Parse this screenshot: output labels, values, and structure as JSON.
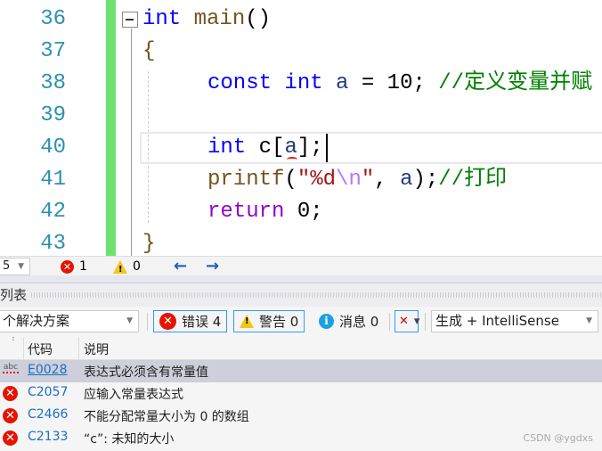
{
  "editor": {
    "line_numbers": [
      "36",
      "37",
      "38",
      "39",
      "40",
      "41",
      "42",
      "43"
    ],
    "lines": [
      [
        {
          "t": "int",
          "c": "kw"
        },
        {
          "t": " main",
          "c": "fn"
        },
        {
          "t": "()",
          "c": "pl"
        }
      ],
      [
        {
          "t": "{",
          "c": "fn"
        }
      ],
      [
        {
          "t": "const",
          "c": "kw"
        },
        {
          "t": " ",
          "c": "pl"
        },
        {
          "t": "int",
          "c": "kw"
        },
        {
          "t": " a",
          "c": "id"
        },
        {
          "t": " = 10; ",
          "c": "pl"
        },
        {
          "t": "//定义变量并赋",
          "c": "cm"
        }
      ],
      [],
      [
        {
          "t": "int",
          "c": "kw"
        },
        {
          "t": " c[",
          "c": "pl"
        },
        {
          "t": "a",
          "c": "id"
        },
        {
          "t": "];",
          "c": "pl"
        }
      ],
      [
        {
          "t": "printf",
          "c": "fn"
        },
        {
          "t": "(",
          "c": "pl"
        },
        {
          "t": "\"%d",
          "c": "st"
        },
        {
          "t": "\\n",
          "c": "esc"
        },
        {
          "t": "\"",
          "c": "st"
        },
        {
          "t": ", ",
          "c": "pl"
        },
        {
          "t": "a",
          "c": "id"
        },
        {
          "t": ");",
          "c": "pl"
        },
        {
          "t": "//打印",
          "c": "cm"
        }
      ],
      [
        {
          "t": "return",
          "c": "ret"
        },
        {
          "t": " 0;",
          "c": "pl"
        }
      ],
      [
        {
          "t": "}",
          "c": "fn"
        }
      ]
    ]
  },
  "statusbar": {
    "zoom_partial": "5",
    "errors": "1",
    "warnings": "0",
    "back": "←",
    "forward": "→"
  },
  "panel": {
    "title_partial": "列表",
    "scope_dropdown": "个解决方案",
    "errors_btn": "错误 4",
    "warnings_btn": "警告 0",
    "messages_btn": "消息 0",
    "source_dropdown": "生成 + IntelliSense",
    "columns": {
      "code": "代码",
      "desc": "说明"
    },
    "rows": [
      {
        "icon": "intellisense-abc-icon",
        "code": "E0028",
        "desc": "表达式必须含有常量值",
        "selected": true
      },
      {
        "icon": "error-icon",
        "code": "C2057",
        "desc": "应输入常量表达式"
      },
      {
        "icon": "error-icon",
        "code": "C2466",
        "desc": "不能分配常量大小为 0 的数组"
      },
      {
        "icon": "error-icon",
        "code": "C2133",
        "desc": "“c”: 未知的大小"
      }
    ]
  },
  "watermark": "CSDN @ygdxs",
  "colors": {
    "keyword": "#0000ff",
    "comment": "#008000",
    "line_number": "#2b91af",
    "error": "#e51400",
    "change_bar": "#6ee26e"
  }
}
